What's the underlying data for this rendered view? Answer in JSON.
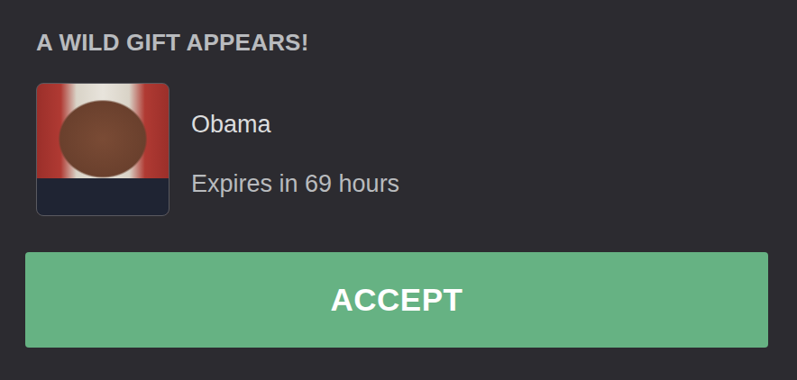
{
  "embed": {
    "title": "A WILD GIFT APPEARS!"
  },
  "gift": {
    "name": "Obama",
    "expiry": "Expires in 69 hours"
  },
  "button": {
    "label": "ACCEPT"
  }
}
